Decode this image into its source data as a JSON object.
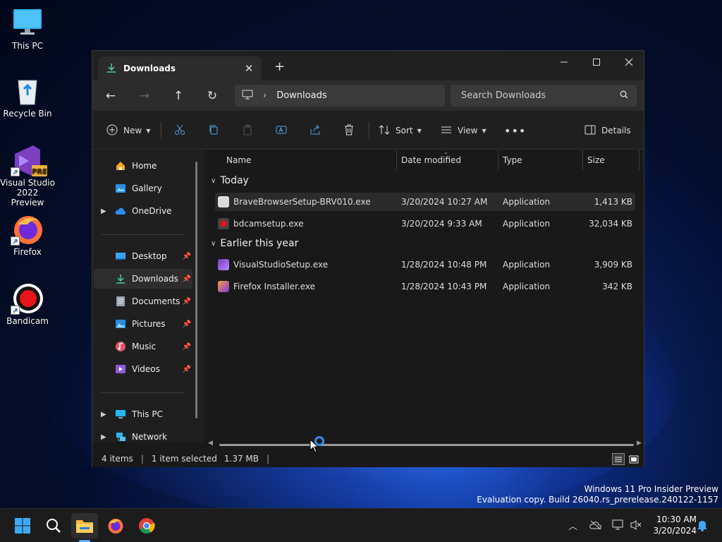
{
  "desktop": {
    "icons": [
      {
        "label": "This PC"
      },
      {
        "label": "Recycle Bin"
      },
      {
        "label": "Visual Studio\n2022 Preview"
      },
      {
        "label": "Firefox"
      },
      {
        "label": "Bandicam"
      }
    ]
  },
  "window": {
    "tab_title": "Downloads",
    "address_path": "Downloads",
    "search_placeholder": "Search Downloads",
    "toolbar": {
      "new_label": "New",
      "sort_label": "Sort",
      "view_label": "View",
      "details_label": "Details"
    },
    "nav": {
      "home": "Home",
      "gallery": "Gallery",
      "onedrive": "OneDrive",
      "desktop": "Desktop",
      "downloads": "Downloads",
      "documents": "Documents",
      "pictures": "Pictures",
      "music": "Music",
      "videos": "Videos",
      "this_pc": "This PC",
      "network": "Network"
    },
    "columns": {
      "name": "Name",
      "date": "Date modified",
      "type": "Type",
      "size": "Size"
    },
    "groups": {
      "today": "Today",
      "earlier": "Earlier this year"
    },
    "files": [
      {
        "name": "BraveBrowserSetup-BRV010.exe",
        "date": "3/20/2024 10:27 AM",
        "type": "Application",
        "size": "1,413 KB"
      },
      {
        "name": "bdcamsetup.exe",
        "date": "3/20/2024 9:33 AM",
        "type": "Application",
        "size": "32,034 KB"
      },
      {
        "name": "VisualStudioSetup.exe",
        "date": "1/28/2024 10:48 PM",
        "type": "Application",
        "size": "3,909 KB"
      },
      {
        "name": "Firefox Installer.exe",
        "date": "1/28/2024 10:43 PM",
        "type": "Application",
        "size": "342 KB"
      }
    ],
    "status": {
      "items": "4 items",
      "selected": "1 item selected",
      "selected_size": "1.37 MB"
    }
  },
  "taskbar": {
    "time": "10:30 AM",
    "date": "3/20/2024"
  },
  "watermark": {
    "line1": "Windows 11 Pro Insider Preview",
    "line2": "Evaluation copy. Build 26040.rs_prerelease.240122-1157"
  },
  "colors": {
    "accent": "#5aa9ff",
    "window_bg": "#191919",
    "taskbar_bg": "#1c1c1c"
  }
}
